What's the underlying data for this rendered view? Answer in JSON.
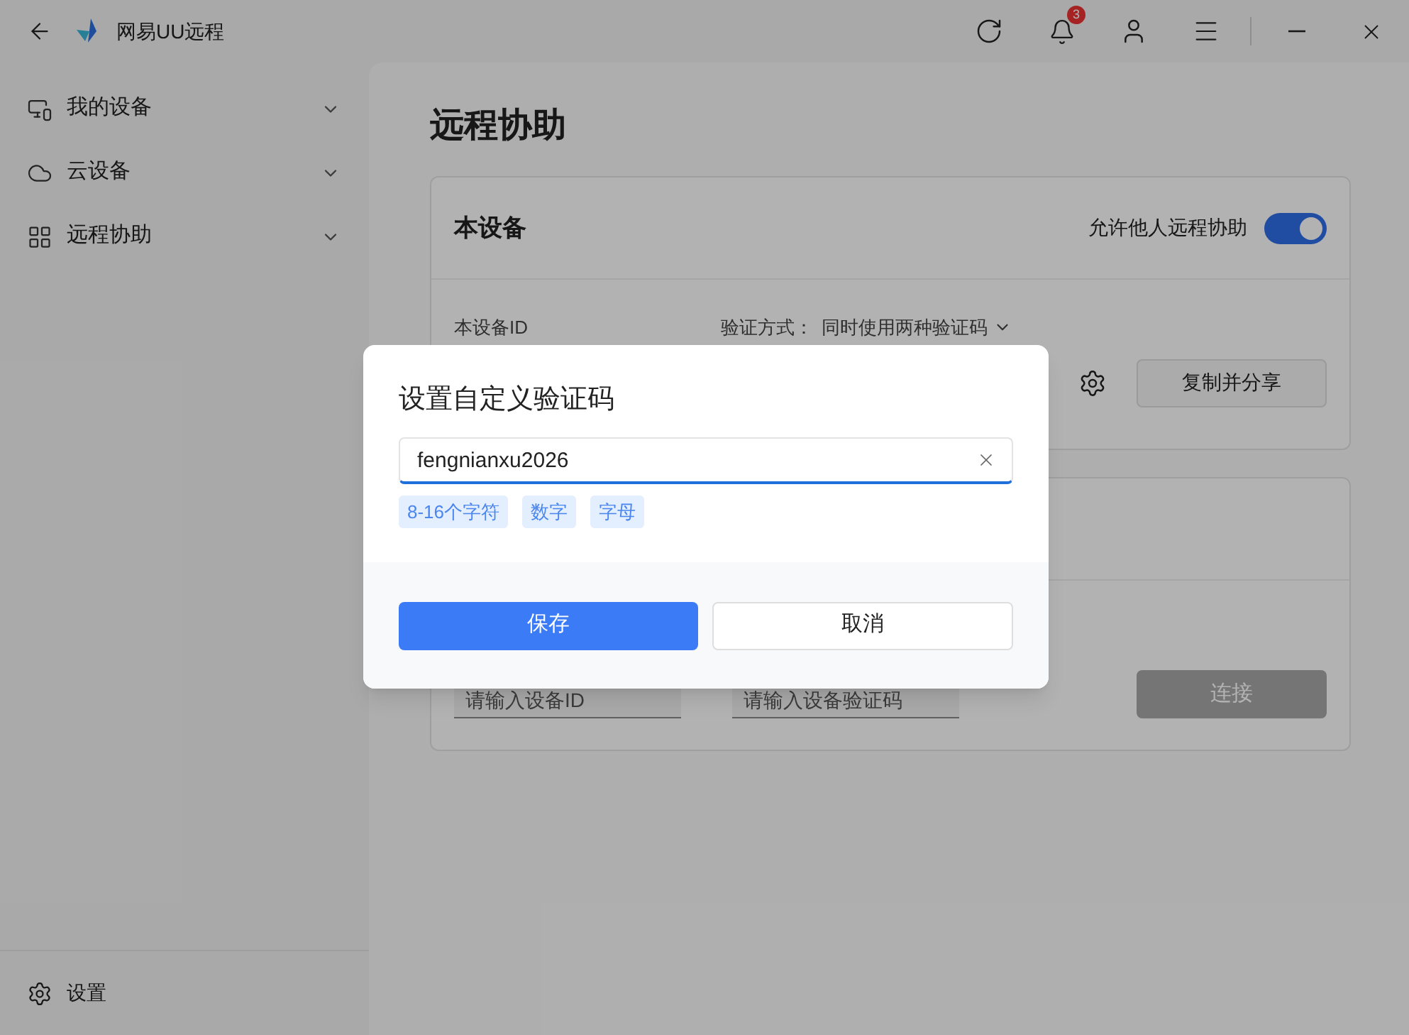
{
  "app": {
    "title": "网易UU远程",
    "notification_count": "3"
  },
  "sidebar": {
    "items": [
      {
        "label": "我的设备",
        "kind": "devices"
      },
      {
        "label": "云设备",
        "kind": "cloud"
      },
      {
        "label": "远程协助",
        "kind": "assist"
      }
    ],
    "footer": "设置"
  },
  "page_title": "远程协助",
  "this_device": {
    "title": "本设备",
    "allow_label": "允许他人远程协助",
    "allow_on": true,
    "id_label": "本设备ID",
    "verify_label": "验证方式：",
    "verify_value": "同时使用两种验证码",
    "share_button": "复制并分享"
  },
  "connect": {
    "id_placeholder": "请输入设备ID",
    "code_placeholder": "请输入设备验证码",
    "connect_button": "连接",
    "connect_disabled": true
  },
  "dialog": {
    "title": "设置自定义验证码",
    "value": "fengnianxu2026",
    "hints": [
      "8-16个字符",
      "数字",
      "字母"
    ],
    "buttons": [
      {
        "label": "保存",
        "kind": "primary"
      },
      {
        "label": "取消",
        "kind": "secondary"
      }
    ]
  }
}
